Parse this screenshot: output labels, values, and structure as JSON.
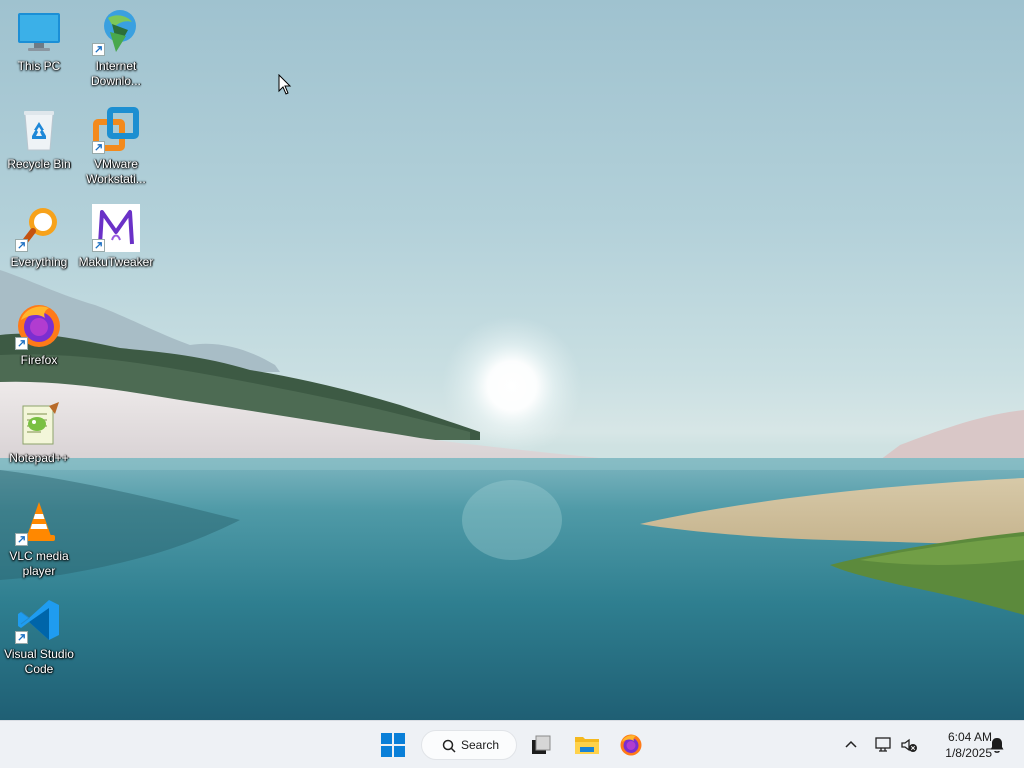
{
  "desktop": {
    "icons": [
      {
        "label": "This PC",
        "icon": "monitor-icon",
        "shortcut": false
      },
      {
        "label": "Internet Downlo...",
        "icon": "internet-download-manager-icon",
        "shortcut": true
      },
      {
        "label": "Recycle Bin",
        "icon": "recycle-bin-icon",
        "shortcut": false
      },
      {
        "label": "VMware Workstati...",
        "icon": "vmware-icon",
        "shortcut": true
      },
      {
        "label": "Everything",
        "icon": "everything-search-icon",
        "shortcut": true
      },
      {
        "label": "MakuTweaker",
        "icon": "makutweaker-icon",
        "shortcut": true
      },
      {
        "label": "Firefox",
        "icon": "firefox-icon",
        "shortcut": true
      },
      {
        "label": "Notepad++",
        "icon": "notepad-plus-plus-icon",
        "shortcut": false
      },
      {
        "label": "VLC media player",
        "icon": "vlc-icon",
        "shortcut": true
      },
      {
        "label": "Visual Studio Code",
        "icon": "vscode-icon",
        "shortcut": true
      }
    ]
  },
  "taskbar": {
    "search_label": "Search",
    "clock_time": "6:04 AM",
    "clock_date": "1/8/2025",
    "accent": "#0078d4"
  }
}
